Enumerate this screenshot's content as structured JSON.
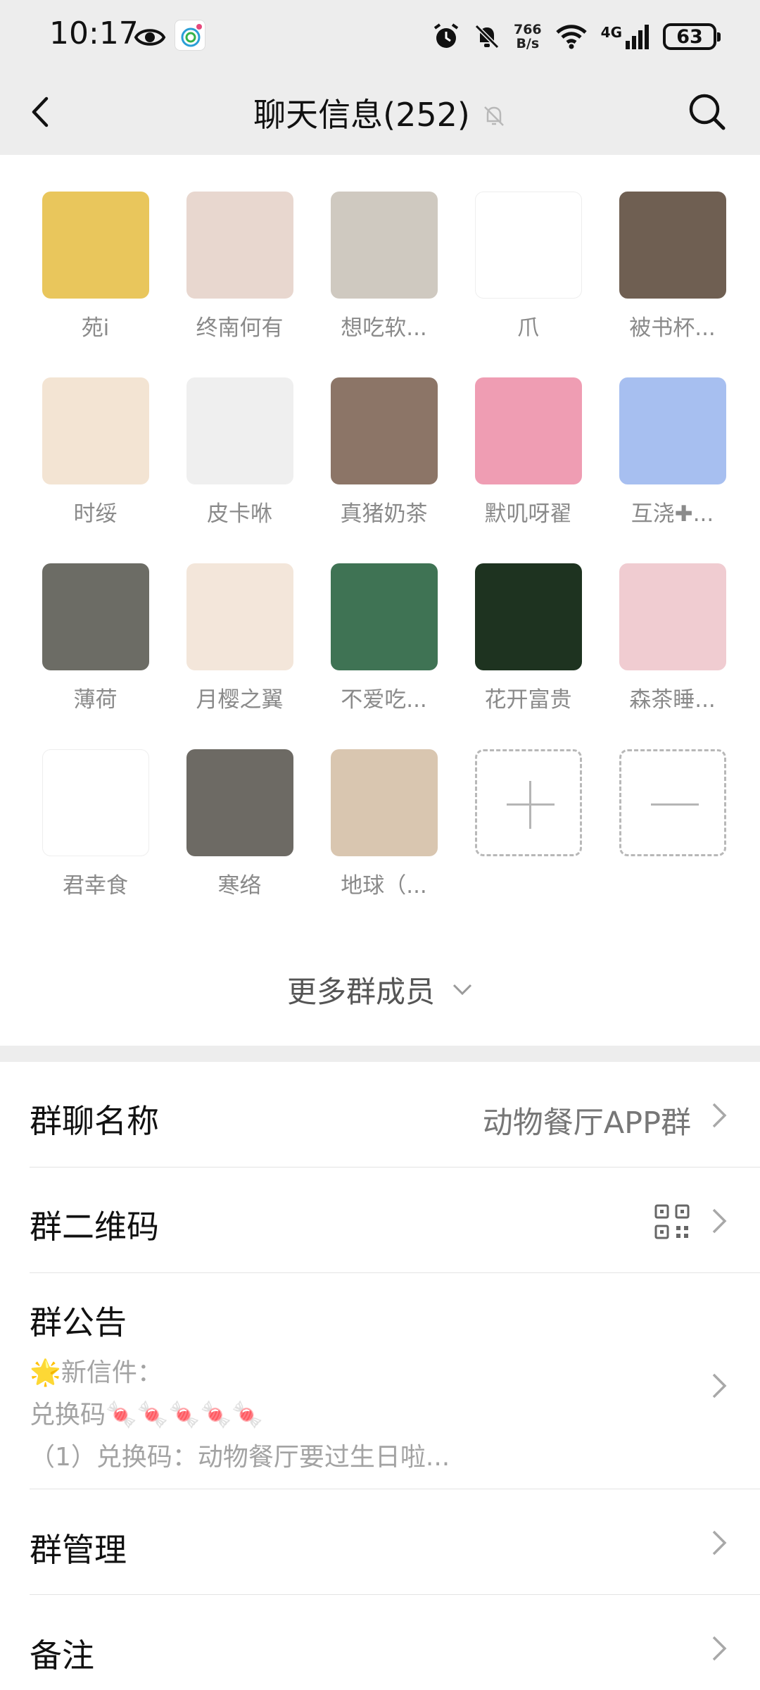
{
  "status_bar": {
    "time": "10:17",
    "net_speed_value": "766",
    "net_speed_unit": "B/s",
    "network_type": "4G",
    "battery": "63"
  },
  "header": {
    "title": "聊天信息(252)"
  },
  "members": [
    {
      "name": "苑i",
      "color": "#e9c65c"
    },
    {
      "name": "终南何有",
      "color": "#e8d7cf"
    },
    {
      "name": "想吃软...",
      "color": "#cfc9c0"
    },
    {
      "name": "爪",
      "color": "#ffffff"
    },
    {
      "name": "被书杯...",
      "color": "#6f5f52"
    },
    {
      "name": "时绥",
      "color": "#f3e4d3"
    },
    {
      "name": "皮卡咻",
      "color": "#efefef"
    },
    {
      "name": "真猪奶茶",
      "color": "#8c7567"
    },
    {
      "name": "默叽呀翟",
      "color": "#ef9db3"
    },
    {
      "name": "互浇✚...",
      "color": "#a7bff0"
    },
    {
      "name": "薄荷",
      "color": "#6c6c65"
    },
    {
      "name": "月樱之翼",
      "color": "#f3e6da"
    },
    {
      "name": "不爱吃...",
      "color": "#3f7354"
    },
    {
      "name": "花开富贵",
      "color": "#1e3320"
    },
    {
      "name": "森茶睡...",
      "color": "#f0ccd1"
    },
    {
      "name": "君幸食",
      "color": "#ffffff"
    },
    {
      "name": "寒络",
      "color": "#6d6a64"
    },
    {
      "name": "地球（...",
      "color": "#d9c6b0"
    }
  ],
  "more_members_label": "更多群成员",
  "settings": {
    "group_name_label": "群聊名称",
    "group_name_value": "动物餐厅APP群",
    "qr_label": "群二维码",
    "notice_label": "群公告",
    "notice_line1": "🌟新信件：",
    "notice_line2": "兑换码🍬🍬🍬🍬🍬",
    "notice_line3": "（1）兑换码：动物餐厅要过生日啦...",
    "manage_label": "群管理",
    "remark_label": "备注"
  }
}
